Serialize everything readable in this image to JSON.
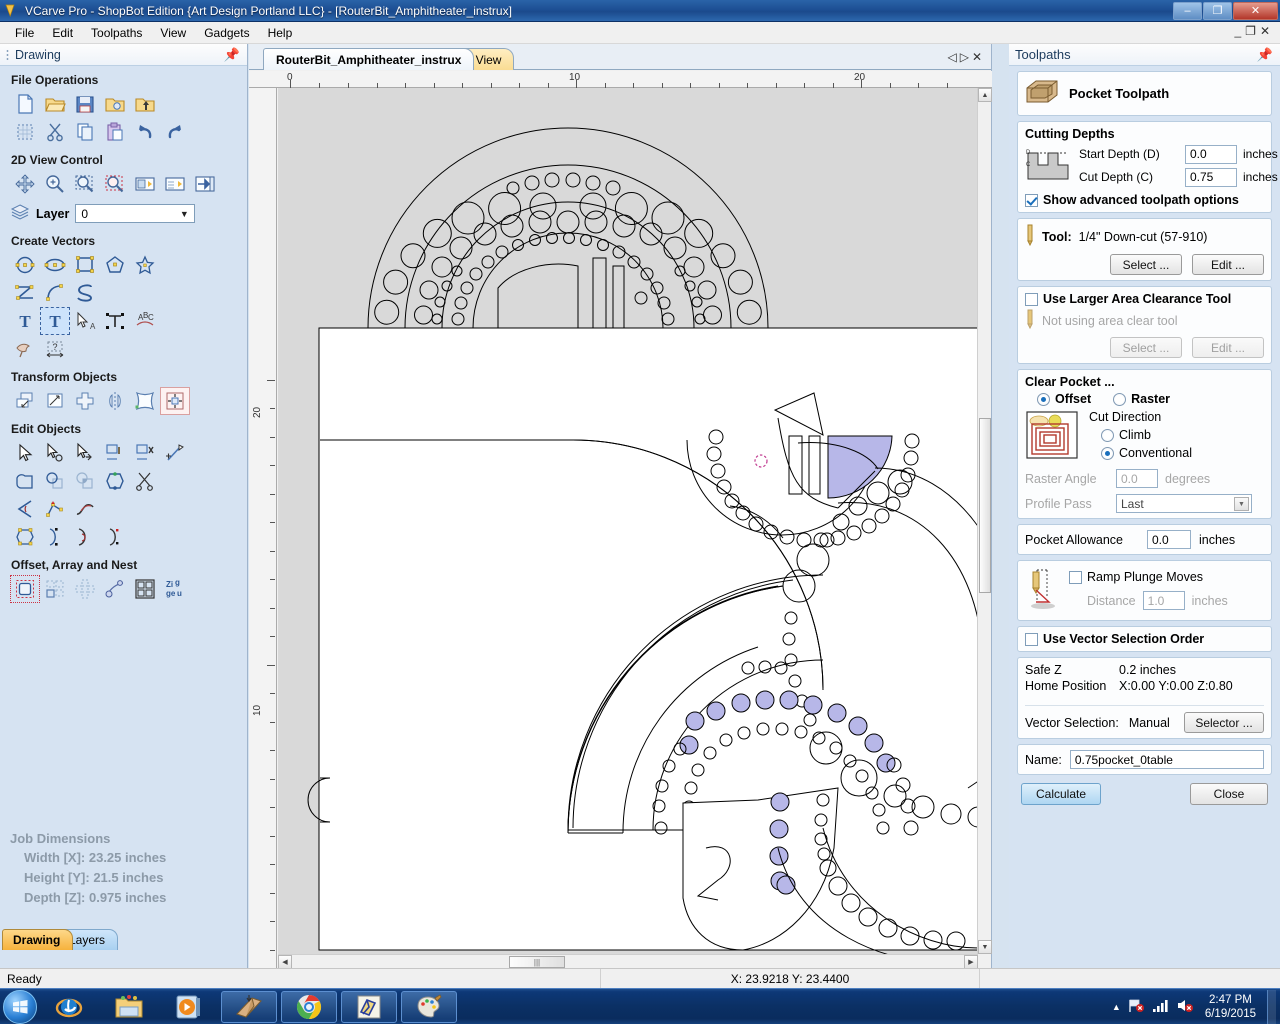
{
  "window": {
    "title": "VCarve Pro - ShopBot Edition {Art Design Portland LLC} - [RouterBit_Amphitheater_instrux]",
    "minimize": "–",
    "maximize": "❐",
    "close": "✕",
    "inner_minimize": "_",
    "inner_restore": "❐",
    "inner_close": "✕"
  },
  "menu": {
    "items": [
      "File",
      "Edit",
      "Toolpaths",
      "View",
      "Gadgets",
      "Help"
    ]
  },
  "left_panel": {
    "header": "Drawing",
    "sections": [
      {
        "title": "File Operations",
        "rows": [
          [
            "new-file-icon",
            "open-folder-icon",
            "save-icon",
            "open-recent-icon",
            "import-icon"
          ],
          [
            "select-all-icon",
            "cut-icon",
            "copy-icon",
            "paste-icon",
            "undo-icon",
            "redo-icon"
          ]
        ]
      },
      {
        "title": "2D View Control",
        "rows": [
          [
            "pan-icon",
            "zoom-in-icon",
            "zoom-extents-icon",
            "zoom-box-icon",
            "zoom-selected-icon",
            "zoom-fit-icon",
            "toggle-panel-icon"
          ]
        ]
      },
      {
        "title": "Create Vectors",
        "rows": [
          [
            "circle-icon",
            "ellipse-icon",
            "rectangle-icon",
            "polygon-icon",
            "star-icon"
          ],
          [
            "polyline-icon",
            "arc-icon",
            "curve-icon"
          ],
          [
            "text-icon",
            "text-box-icon",
            "text-select-icon",
            "text-transform-icon",
            "text-on-curve-icon"
          ],
          [
            "trace-bitmap-icon",
            "dimension-icon"
          ]
        ]
      },
      {
        "title": "Transform Objects",
        "rows": [
          [
            "move-icon",
            "scale-icon",
            "rotate-icon",
            "mirror-icon",
            "distort-icon",
            "align-icon"
          ]
        ]
      },
      {
        "title": "Edit Objects",
        "rows": [
          [
            "select-arrow-icon",
            "node-edit-icon",
            "move-nodes-icon",
            "group-icon",
            "ungroup-icon",
            "measure-icon"
          ],
          [
            "weld-icon",
            "subtract-icon",
            "intersect-icon",
            "join-vectors-icon",
            "trim-icon"
          ],
          [
            "fillet-icon",
            "insert-node-icon",
            "smooth-node-icon"
          ],
          [
            "close-vector-icon",
            "curve-node-icon",
            "line-node-icon",
            "point-node-icon"
          ]
        ]
      },
      {
        "title": "Offset, Array and Nest",
        "rows": [
          [
            "offset-icon",
            "block-copy-icon",
            "rotate-copy-icon",
            "copy-along-curve-icon",
            "nest-icon",
            "zigzag-icon"
          ]
        ]
      }
    ],
    "layer": {
      "label": "Layer",
      "value": "0",
      "icon": "layers-icon"
    },
    "job_dimensions": {
      "title": "Job Dimensions",
      "width": "Width  [X]: 23.25 inches",
      "height": "Height [Y]: 21.5 inches",
      "depth": "Depth  [Z]: 0.975 inches"
    },
    "tabs": [
      {
        "label": "Drawing",
        "active": true
      },
      {
        "label": "Layers",
        "active": false
      }
    ]
  },
  "center": {
    "tabs": [
      {
        "label": "RouterBit_Amphitheater_instrux",
        "active": true
      },
      {
        "label": "3D View",
        "active": false
      }
    ],
    "tab_nav": {
      "prev": "◁",
      "next": "▷",
      "close": "✕"
    },
    "h_ruler_labels": [
      "0",
      "10",
      "20"
    ],
    "v_ruler_labels": [
      "20",
      "10"
    ]
  },
  "toolpaths": {
    "header": "Toolpaths",
    "pin_icon": "pin-icon",
    "type_title": "Pocket Toolpath",
    "type_icon": "pocket-toolpath-icon",
    "cutting_depths": {
      "title": "Cutting Depths",
      "start_depth_label": "Start Depth (D)",
      "start_depth_value": "0.0",
      "cut_depth_label": "Cut Depth (C)",
      "cut_depth_value": "0.75",
      "units": "inches",
      "advanced_label": "Show advanced toolpath options",
      "advanced_checked": true
    },
    "tool": {
      "label": "Tool:",
      "value": "1/4\" Down-cut (57-910)",
      "select_btn": "Select ...",
      "edit_btn": "Edit ..."
    },
    "area_clear": {
      "checkbox_label": "Use Larger Area Clearance Tool",
      "checked": false,
      "status": "Not using area clear tool",
      "select_btn": "Select ...",
      "edit_btn": "Edit ..."
    },
    "clear_pocket": {
      "title": "Clear Pocket ...",
      "offset_label": "Offset",
      "raster_label": "Raster",
      "strategy_selected": "Offset",
      "cut_direction_label": "Cut Direction",
      "climb_label": "Climb",
      "conventional_label": "Conventional",
      "direction_selected": "Conventional",
      "raster_angle_label": "Raster Angle",
      "raster_angle_value": "0.0",
      "degrees": "degrees",
      "profile_pass_label": "Profile Pass",
      "profile_pass_value": "Last",
      "preview_icon": "offset-pocket-preview-icon"
    },
    "pocket_allowance": {
      "label": "Pocket Allowance",
      "value": "0.0",
      "units": "inches"
    },
    "ramp": {
      "checkbox_label": "Ramp Plunge Moves",
      "checked": false,
      "distance_label": "Distance",
      "distance_value": "1.0",
      "units": "inches",
      "icon": "ramp-plunge-icon"
    },
    "vector_order": {
      "checkbox_label": "Use Vector Selection Order",
      "checked": false
    },
    "positions": {
      "safe_z_label": "Safe Z",
      "safe_z_value": "0.2 inches",
      "home_label": "Home Position",
      "home_value": "X:0.00 Y:0.00 Z:0.80",
      "vector_selection_label": "Vector Selection:",
      "vector_selection_value": "Manual",
      "selector_btn": "Selector ..."
    },
    "name": {
      "label": "Name:",
      "value": "0.75pocket_0table"
    },
    "actions": {
      "calculate": "Calculate",
      "close": "Close"
    }
  },
  "status_bar": {
    "message": "Ready",
    "coordinates": "X: 23.9218 Y: 23.4400"
  },
  "taskbar": {
    "start_icon": "windows-start-icon",
    "items": [
      {
        "icon": "internet-explorer-icon",
        "framed": false
      },
      {
        "icon": "file-explorer-icon",
        "framed": false
      },
      {
        "icon": "media-player-icon",
        "framed": false
      },
      {
        "icon": "vcarve-pro-icon",
        "framed": true
      },
      {
        "icon": "google-chrome-icon",
        "framed": true
      },
      {
        "icon": "shopbot-icon",
        "framed": true
      },
      {
        "icon": "paint-icon",
        "framed": true
      }
    ],
    "tray": {
      "show_hidden_icon": "chevron-up-icon",
      "network_icon": "network-error-icon",
      "signal_icon": "signal-bars-icon",
      "volume_icon": "volume-muted-icon",
      "time": "2:47 PM",
      "date": "6/19/2015"
    }
  },
  "colors": {
    "titlebar": "#1d4f94",
    "panel_bg": "#d6e3f2",
    "accent": "#1a6fbc",
    "selection_fill": "#b7b7e8",
    "canvas_bg": "#d9d9d9",
    "sheet_bg": "#ffffff"
  }
}
